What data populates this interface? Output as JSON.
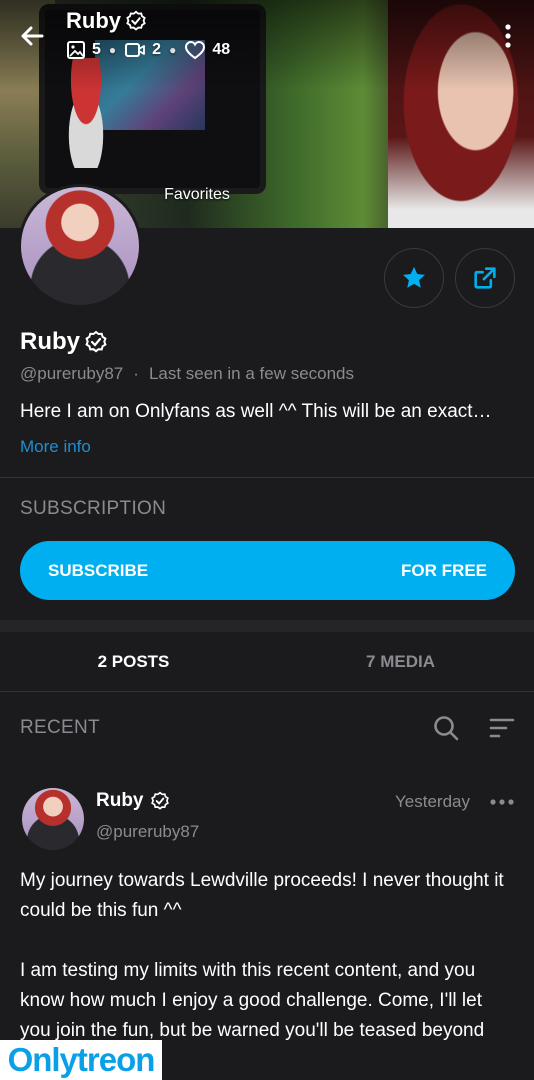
{
  "header": {
    "title": "Ruby",
    "stats": {
      "photos": "5",
      "videos": "2",
      "likes": "48"
    },
    "cover_caption": "Favorites"
  },
  "profile": {
    "name": "Ruby",
    "handle": "@pureruby87",
    "separator": "·",
    "last_seen": "Last seen in a few seconds",
    "bio": "Here I am on Onlyfans as well ^^ This will be an exact…",
    "more_info": "More info"
  },
  "subscription": {
    "section_label": "SUBSCRIPTION",
    "button_left": "SUBSCRIBE",
    "button_right": "FOR FREE"
  },
  "tabs": [
    {
      "label": "2 POSTS",
      "active": true
    },
    {
      "label": "7 MEDIA",
      "active": false
    }
  ],
  "recent": {
    "label": "RECENT"
  },
  "post": {
    "author": "Ruby",
    "handle": "@pureruby87",
    "time": "Yesterday",
    "paragraphs": [
      "My journey towards Lewdville proceeds! I never thought it could be this fun ^^",
      "I am testing my limits with this recent content, and you know how much I enjoy a good challenge. Come, I'll let you join the fun, but be warned you'll be teased beyond"
    ]
  },
  "watermark": {
    "part1": "Only",
    "part2": "treon"
  },
  "colors": {
    "accent": "#00aff0",
    "background": "#1b1b1d",
    "muted": "#8a8a90",
    "link": "#1d8fcf"
  },
  "icons": [
    "back-arrow-icon",
    "verified-icon",
    "image-icon",
    "video-icon",
    "heart-icon",
    "more-vertical-icon",
    "star-icon",
    "share-icon",
    "search-icon",
    "filter-icon",
    "more-horizontal-icon"
  ]
}
